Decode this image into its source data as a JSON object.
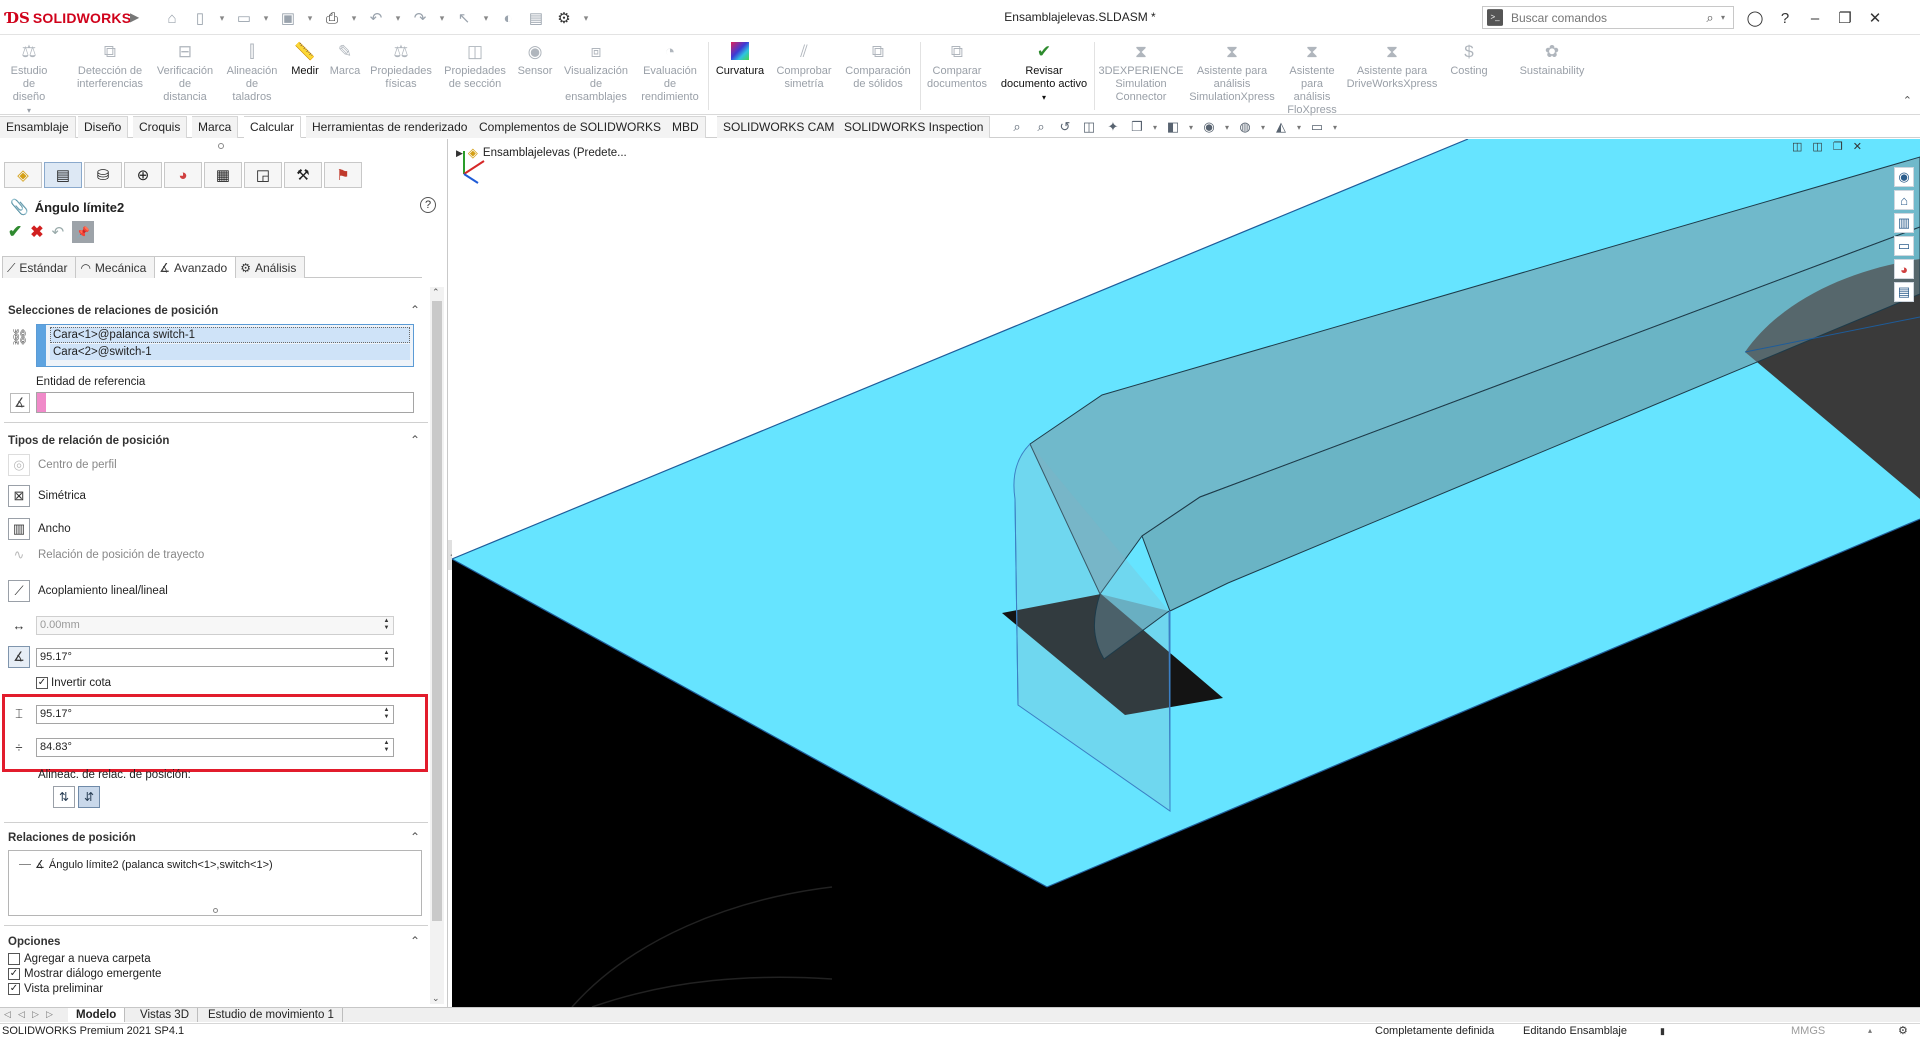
{
  "titlebar": {
    "app_name": "SOLIDWORKS",
    "document_title": "Ensamblajelevas.SLDASM *",
    "search_placeholder": "Buscar comandos",
    "quick_icons": [
      "home-icon",
      "new-icon",
      "open-icon",
      "save-icon",
      "print-icon",
      "undo-icon",
      "redo-icon",
      "select-icon",
      "rebuild-icon",
      "file-props-icon",
      "options-icon"
    ]
  },
  "ribbon": {
    "buttons": [
      {
        "label": "Estudio de\ndiseño",
        "active": false
      },
      {
        "label": "Detección de\ninterferencias",
        "active": false
      },
      {
        "label": "Verificación\nde\ndistancia",
        "active": false
      },
      {
        "label": "Alineación\nde\ntaladros",
        "active": false
      },
      {
        "label": "Medir",
        "active": true
      },
      {
        "label": "Marca",
        "active": false
      },
      {
        "label": "Propiedades\nfísicas",
        "active": false
      },
      {
        "label": "Propiedades\nde sección",
        "active": false
      },
      {
        "label": "Sensor",
        "active": false
      },
      {
        "label": "Visualización\nde\nensamblajes",
        "active": false
      },
      {
        "label": "Evaluación\nde\nrendimiento",
        "active": false
      },
      {
        "label": "Curvatura",
        "active": true
      },
      {
        "label": "Comprobar\nsimetría",
        "active": false
      },
      {
        "label": "Comparación\nde sólidos",
        "active": false
      },
      {
        "label": "Comparar\ndocumentos",
        "active": false
      },
      {
        "label": "Revisar\ndocumento activo",
        "active": true
      },
      {
        "label": "3DEXPERIENCE\nSimulation\nConnector",
        "active": false
      },
      {
        "label": "Asistente para\nanálisis\nSimulationXpress",
        "active": false
      },
      {
        "label": "Asistente\npara\nanálisis\nFloXpress",
        "active": false
      },
      {
        "label": "Asistente para\nDriveWorksXpress",
        "active": false
      },
      {
        "label": "Costing",
        "active": false
      },
      {
        "label": "Sustainability",
        "active": false
      }
    ]
  },
  "command_tabs": [
    "Ensamblaje",
    "Diseño",
    "Croquis",
    "Marca",
    "Calcular",
    "Herramientas de renderizado",
    "Complementos de SOLIDWORKS",
    "MBD",
    "SOLIDWORKS CAM",
    "SOLIDWORKS Inspection"
  ],
  "active_command_tab": "Calcular",
  "property_manager": {
    "title": "Ángulo límite2",
    "mate_tabs": [
      "Estándar",
      "Mecánica",
      "Avanzado",
      "Análisis"
    ],
    "active_mate_tab": "Avanzado",
    "selections_title": "Selecciones de relaciones de posición",
    "selections": [
      "Cara<1>@palanca switch-1",
      "Cara<2>@switch-1"
    ],
    "reference_label": "Entidad de referencia",
    "reference_value": "",
    "types_title": "Tipos de relación de posición",
    "types": [
      {
        "label": "Centro de perfil",
        "enabled": false
      },
      {
        "label": "Simétrica",
        "enabled": true
      },
      {
        "label": "Ancho",
        "enabled": true
      },
      {
        "label": "Relación de posición de trayecto",
        "enabled": false
      },
      {
        "label": "Acoplamiento lineal/lineal",
        "enabled": true
      }
    ],
    "distance_value": "0.00mm",
    "angle_value": "95.17°",
    "invert_label": "Invertir cota",
    "invert_checked": true,
    "max_value": "95.17°",
    "min_value": "84.83°",
    "alignment_label": "Alineac. de relac. de posición:",
    "mates_title": "Relaciones de posición",
    "mates": [
      "Ángulo límite2 (palanca switch<1>,switch<1>)"
    ],
    "options_title": "Opciones",
    "options": [
      {
        "label": "Agregar a nueva carpeta",
        "checked": false
      },
      {
        "label": "Mostrar diálogo emergente",
        "checked": true
      },
      {
        "label": "Vista preliminar",
        "checked": true
      }
    ]
  },
  "tree_root": "Ensamblajelevas  (Predete...",
  "bottom_tabs": [
    "Modelo",
    "Vistas 3D",
    "Estudio de movimiento 1"
  ],
  "active_bottom_tab": "Modelo",
  "status": {
    "product": "SOLIDWORKS Premium 2021 SP4.1",
    "definition": "Completamente definida",
    "mode": "Editando Ensamblaje",
    "units": "MMGS"
  },
  "colors": {
    "plane": "#66e4ff",
    "tab_part": "#9fd1e0",
    "highlight": "#e21c2c",
    "selection": "#5da3e0",
    "reference": "#f08ac9"
  }
}
